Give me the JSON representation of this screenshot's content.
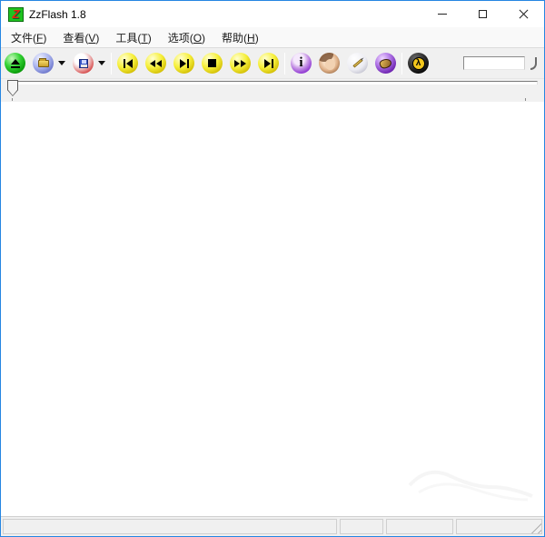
{
  "window": {
    "title": "ZzFlash 1.8",
    "app_icon": {
      "name": "zzflash-app-icon",
      "glyph": "Z",
      "bg": "#1fc320",
      "fg": "#e8250e"
    },
    "controls": [
      {
        "name": "minimize"
      },
      {
        "name": "maximize"
      },
      {
        "name": "close"
      }
    ]
  },
  "menubar": {
    "items": [
      {
        "pre": "文件(",
        "key": "F",
        "post": ")"
      },
      {
        "pre": "查看(",
        "key": "V",
        "post": ")"
      },
      {
        "pre": "工具(",
        "key": "T",
        "post": ")"
      },
      {
        "pre": "选项(",
        "key": "O",
        "post": ")"
      },
      {
        "pre": "帮助(",
        "key": "H",
        "post": ")"
      }
    ]
  },
  "toolbar": {
    "buttons": [
      {
        "name": "eject",
        "icon": "eject-icon",
        "sphere_color": "green"
      },
      {
        "name": "open",
        "icon": "open-folder-icon",
        "sphere_color": "blue",
        "has_dropdown": true
      },
      {
        "name": "save",
        "icon": "save-floppy-icon",
        "sphere_color": "red",
        "has_dropdown": true
      },
      {
        "name": "go-start",
        "icon": "skip-back-icon",
        "sphere_color": "yellow"
      },
      {
        "name": "rewind",
        "icon": "rewind-icon",
        "sphere_color": "yellow"
      },
      {
        "name": "play-pause",
        "icon": "play-pause-icon",
        "sphere_color": "yellow"
      },
      {
        "name": "stop",
        "icon": "stop-icon",
        "sphere_color": "yellow"
      },
      {
        "name": "fast-forward",
        "icon": "fast-forward-icon",
        "sphere_color": "yellow"
      },
      {
        "name": "go-end",
        "icon": "skip-forward-icon",
        "sphere_color": "yellow"
      },
      {
        "name": "info",
        "icon": "info-icon",
        "sphere_color": "purple",
        "glyph": "i"
      },
      {
        "name": "portrait",
        "icon": "portrait-photo-icon",
        "sphere_color": "photo"
      },
      {
        "name": "edit",
        "icon": "pencil-icon",
        "sphere_color": "white"
      },
      {
        "name": "extra-tool",
        "icon": "purple-sphere-icon",
        "sphere_color": "purple"
      },
      {
        "name": "half-life",
        "icon": "lambda-icon",
        "sphere_color": "black",
        "glyph": "λ"
      }
    ],
    "position_box": {
      "value": ""
    }
  },
  "seekbar": {
    "value": 0,
    "thumb_position": "left"
  },
  "statusbar": {
    "panels": [
      "",
      "",
      "",
      ""
    ]
  },
  "colors": {
    "window_border": "#2586e2",
    "titlebar_bg": "#ffffff",
    "menubar_bg": "#f9f9f9",
    "toolbar_bg": "#f0f0f0",
    "content_bg": "#ffffff",
    "statusbar_bg": "#f0f0f0",
    "sphere_green": "#12b212",
    "sphere_blue": "#7b86d6",
    "sphere_red": "#d23b3b",
    "sphere_yellow": "#f0e32a",
    "sphere_purple": "#7a2fd0",
    "halflife_yellow": "#f3c71c"
  }
}
